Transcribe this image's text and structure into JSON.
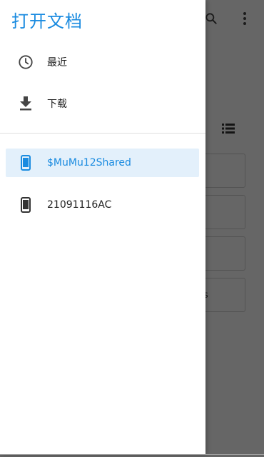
{
  "drawer": {
    "title": "打开文档",
    "items": [
      {
        "label": "最近",
        "icon": "clock-icon"
      },
      {
        "label": "下载",
        "icon": "download-icon"
      }
    ],
    "roots": [
      {
        "label": "$MuMu12Shared",
        "icon": "phone-icon",
        "selected": true
      },
      {
        "label": "21091116AC",
        "icon": "phone-icon",
        "selected": false
      }
    ]
  },
  "background": {
    "toolbar_icons": [
      "search-icon",
      "more-vert-icon"
    ],
    "view_toggle_icon": "list-view-icon",
    "card_hint": "s"
  },
  "colors": {
    "accent": "#1a8be0",
    "selected_bg": "#e3f0fb",
    "scrim": "rgba(0,0,0,0.6)"
  }
}
